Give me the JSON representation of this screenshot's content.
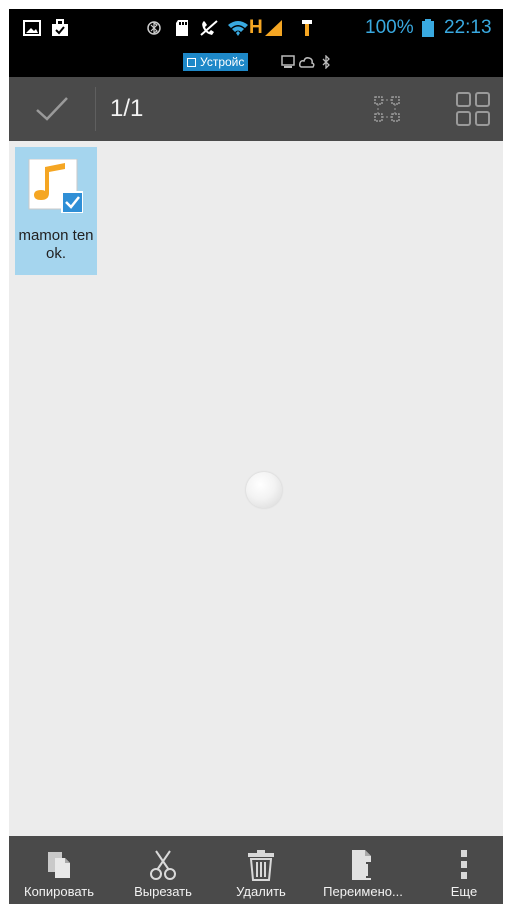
{
  "status_bar": {
    "battery": "100%",
    "time": "22:13",
    "network": "H",
    "icons": [
      "image-icon",
      "briefcase-icon",
      "bluetooth-icon",
      "sd-card-icon",
      "no-call-icon",
      "wifi-icon",
      "signal-icon",
      "signal-alt-icon",
      "battery-icon"
    ],
    "storage_chip": "Устройс",
    "accent_color": "#39a9e0"
  },
  "action_bar": {
    "selection_count": "1/1",
    "buttons": [
      "check-icon",
      "select-all-icon",
      "grid-view-icon"
    ]
  },
  "files": [
    {
      "name": "mamon tenok.",
      "icon": "music-file-icon",
      "selected": true
    }
  ],
  "bottom_toolbar": {
    "copy_label": "Копировать",
    "cut_label": "Вырезать",
    "delete_label": "Удалить",
    "rename_label": "Переимено...",
    "more_label": "Еще"
  },
  "colors": {
    "action_bar_bg": "#4a4a4a",
    "content_bg": "#ececec",
    "selection_bg": "#a5d5ee",
    "file_icon_accent": "#f5a623"
  }
}
